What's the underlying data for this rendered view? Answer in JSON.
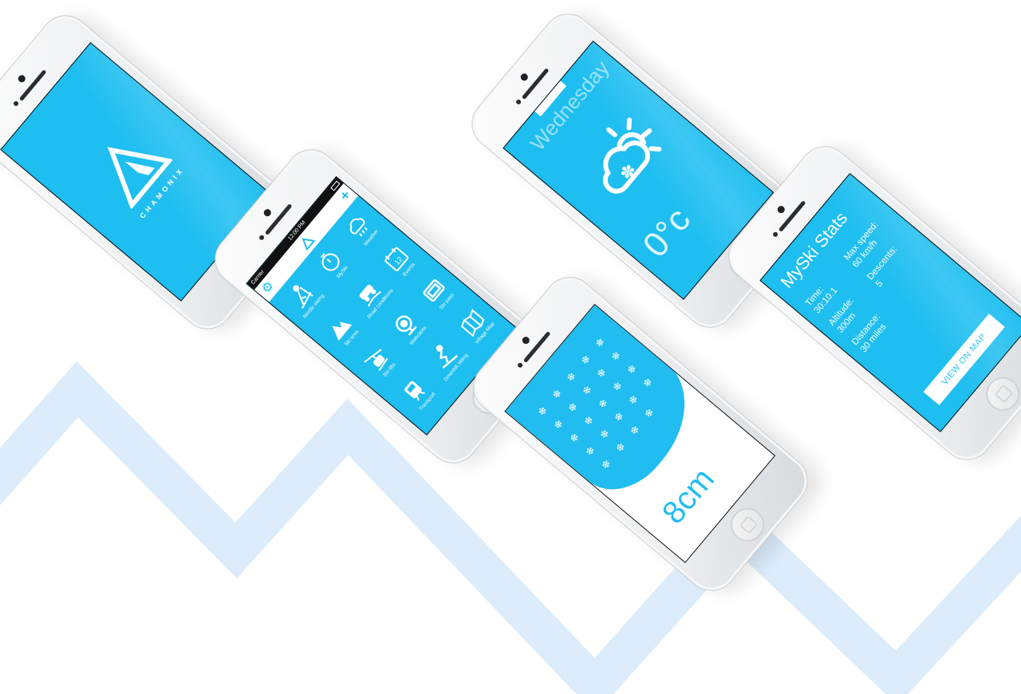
{
  "splash": {
    "brand": "CHAMONIX"
  },
  "menu": {
    "status": {
      "carrier": "Carrier",
      "time": "12:00 PM"
    },
    "items": [
      {
        "label": "Nordic skiing",
        "icon": "nordic-skiing-icon"
      },
      {
        "label": "MySki",
        "icon": "stopwatch-icon"
      },
      {
        "label": "Weather",
        "icon": "weather-icon"
      },
      {
        "label": "Ski area",
        "icon": "mountain-icon"
      },
      {
        "label": "Road conditions",
        "icon": "road-conditions-icon"
      },
      {
        "label": "Events",
        "icon": "calendar-icon"
      },
      {
        "label": "Ski lifts",
        "icon": "ski-lift-icon"
      },
      {
        "label": "Webcams",
        "icon": "webcam-icon"
      },
      {
        "label": "Ski pass",
        "icon": "ski-pass-icon"
      },
      {
        "label": "Transport",
        "icon": "train-icon"
      },
      {
        "label": "Downhill skiing",
        "icon": "downhill-skiing-icon"
      },
      {
        "label": "Village Map",
        "icon": "map-icon"
      }
    ],
    "calendar_day": "12"
  },
  "weather": {
    "day": "Wednesday",
    "temperature": "0°c"
  },
  "snow": {
    "depth": "8cm"
  },
  "stats": {
    "title": "MySki Stats",
    "rows": [
      {
        "label": "Time:",
        "value": "30:10.1"
      },
      {
        "label": "Max speed:",
        "value": "60 km/h"
      },
      {
        "label": "Altitude:",
        "value": "300m"
      },
      {
        "label": "Descents:",
        "value": "5"
      },
      {
        "label": "Distance:",
        "value": "30 miles"
      },
      {
        "label": "",
        "value": ""
      }
    ],
    "button": "VIEW ON MAP"
  },
  "colors": {
    "accent": "#1ebef0",
    "zigzag": "#dcecfa"
  }
}
